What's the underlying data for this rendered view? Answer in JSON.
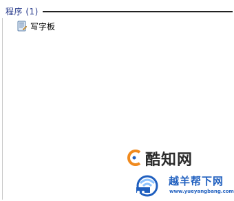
{
  "results": {
    "group_title": "程序 (1)",
    "items": [
      {
        "label": "写字板",
        "icon": "wordpad-icon"
      }
    ]
  },
  "watermarks": {
    "top_text": "酷知网",
    "bottom_text": "越羊帮下网",
    "bottom_url": "www.yueyangbang.com"
  },
  "colors": {
    "group_title": "#1e3287",
    "divider": "#222222",
    "watermark_blue": "#1f5fbf",
    "watermark_orange": "#f08a1e"
  }
}
